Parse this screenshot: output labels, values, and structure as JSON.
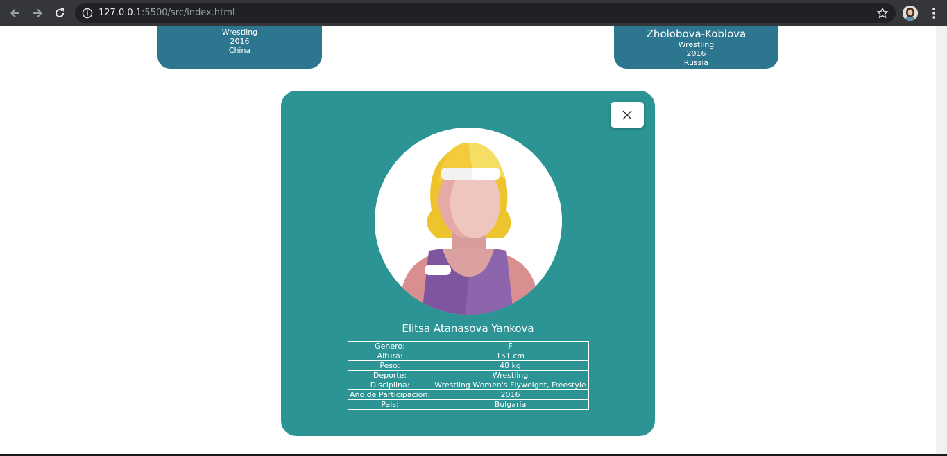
{
  "browser": {
    "url_host": "127.0.0.1",
    "url_rest": ":5500/src/index.html"
  },
  "cards": [
    {
      "lines": [
        "Wrestling",
        "2016",
        "China"
      ]
    },
    {
      "name": "Zholobova-Koblova",
      "lines": [
        "Wrestling",
        "2016",
        "Russia"
      ]
    }
  ],
  "modal": {
    "athlete_name": "Elitsa Atanasova Yankova",
    "details": [
      {
        "label": "Genero:",
        "value": "F"
      },
      {
        "label": "Altura:",
        "value": "151 cm"
      },
      {
        "label": "Peso:",
        "value": "48 kg"
      },
      {
        "label": "Deporte:",
        "value": "Wrestling"
      },
      {
        "label": "Disciplina:",
        "value": "Wrestling Women's Flyweight, Freestyle"
      },
      {
        "label": "Año de Participacion:",
        "value": "2016"
      },
      {
        "label": "Pais:",
        "value": "Bulgaria"
      }
    ]
  },
  "colors": {
    "modal_bg": "#2c9494",
    "card_bg": "#2c7690",
    "chrome_bg": "#35363a"
  },
  "icons": [
    "back-arrow-icon",
    "forward-arrow-icon",
    "reload-icon",
    "info-icon",
    "star-icon",
    "profile-avatar",
    "kebab-menu-icon",
    "close-icon"
  ]
}
